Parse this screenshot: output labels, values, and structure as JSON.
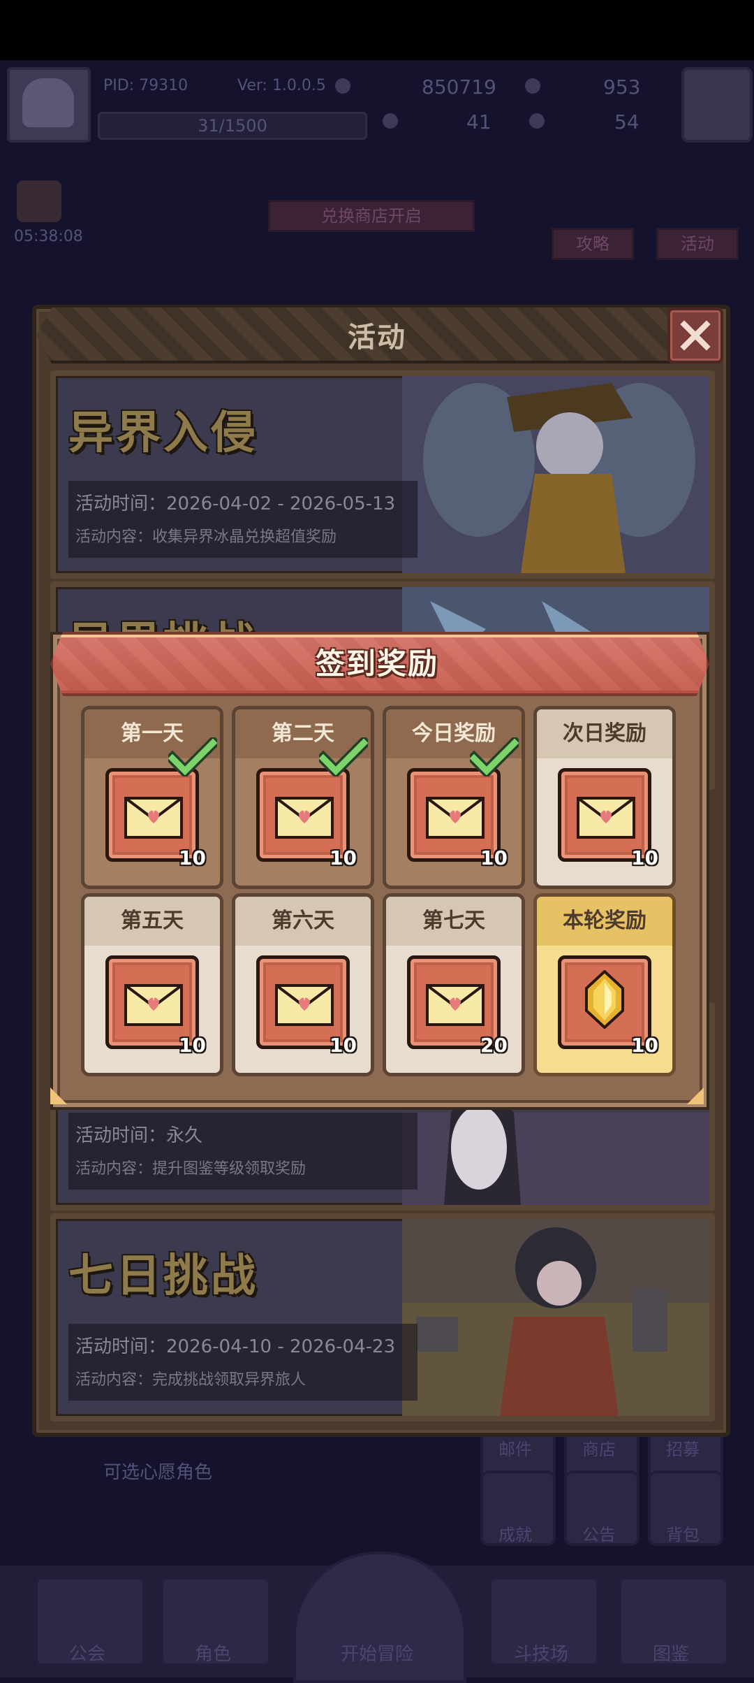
{
  "hud": {
    "pid": "PID: 79310",
    "version": "Ver: 1.0.0.5",
    "gold": "850719",
    "gems": "953",
    "energy": "31/1500",
    "clover": "41",
    "tickets": "54"
  },
  "background": {
    "timer": "05:38:08",
    "exchange_label": "兑换商店开启",
    "guide_label": "攻略",
    "activity_label": "活动",
    "wish_label": "可选心愿角色",
    "side_buttons": [
      "邮件",
      "商店",
      "招募",
      "成就",
      "公告",
      "背包"
    ],
    "nav": [
      "公会",
      "角色",
      "开始冒险",
      "斗技场",
      "图鉴"
    ]
  },
  "panel": {
    "title": "活动",
    "events": [
      {
        "title": "异界入侵",
        "time": "活动时间：2026-04-02 - 2026-05-13",
        "content": "活动内容：收集异界冰晶兑换超值奖励"
      },
      {
        "title": "异界挑战"
      },
      {
        "time": "活动时间：永久",
        "content": "活动内容：提升图鉴等级领取奖励"
      },
      {
        "title": "七日挑战",
        "time": "活动时间：2026-04-10 - 2026-04-23",
        "content": "活动内容：完成挑战领取异界旅人"
      }
    ]
  },
  "signin": {
    "title": "签到奖励",
    "days": [
      {
        "label": "第一天",
        "qty": "10",
        "state": "claimed",
        "icon": "envelope-icon"
      },
      {
        "label": "第二天",
        "qty": "10",
        "state": "claimed",
        "icon": "envelope-icon"
      },
      {
        "label": "今日奖励",
        "qty": "10",
        "state": "claimed",
        "icon": "envelope-icon"
      },
      {
        "label": "次日奖励",
        "qty": "10",
        "state": "future",
        "icon": "envelope-icon"
      },
      {
        "label": "第五天",
        "qty": "10",
        "state": "future",
        "icon": "envelope-icon"
      },
      {
        "label": "第六天",
        "qty": "10",
        "state": "future",
        "icon": "envelope-icon"
      },
      {
        "label": "第七天",
        "qty": "20",
        "state": "future",
        "icon": "envelope-icon"
      },
      {
        "label": "本轮奖励",
        "qty": "10",
        "state": "final",
        "icon": "gold-crystal-icon"
      }
    ]
  },
  "colors": {
    "panel_brown": "#4a3a2c",
    "modal_header": "#d2685a",
    "check_green": "#7ed36a",
    "final_gold": "#f5dc8f"
  }
}
